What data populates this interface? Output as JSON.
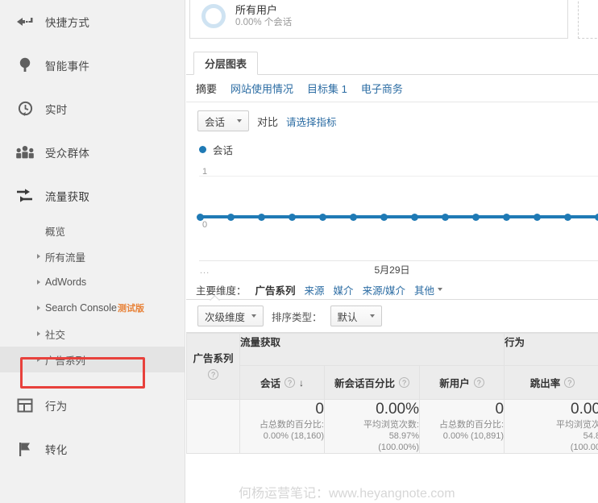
{
  "sidebar": {
    "items": [
      {
        "label": "快捷方式",
        "icon": "shortcut-arrow-icon"
      },
      {
        "label": "智能事件",
        "icon": "lightbulb-icon"
      },
      {
        "label": "实时",
        "icon": "clock-icon"
      },
      {
        "label": "受众群体",
        "icon": "people-group-icon"
      },
      {
        "label": "流量获取",
        "icon": "arrows-icon"
      }
    ],
    "acquisition_sub": [
      {
        "label": "概览",
        "caret": false,
        "highlighted": false,
        "beta": ""
      },
      {
        "label": "所有流量",
        "caret": true,
        "highlighted": false,
        "beta": ""
      },
      {
        "label": "AdWords",
        "caret": true,
        "highlighted": false,
        "beta": ""
      },
      {
        "label": "Search Console",
        "caret": true,
        "highlighted": false,
        "beta": "测试版"
      },
      {
        "label": "社交",
        "caret": true,
        "highlighted": false,
        "beta": ""
      },
      {
        "label": "广告系列",
        "caret": true,
        "highlighted": true,
        "beta": ""
      }
    ],
    "bottom_items": [
      {
        "label": "行为",
        "icon": "layout-icon"
      },
      {
        "label": "转化",
        "icon": "flag-icon"
      }
    ]
  },
  "segment": {
    "title": "所有用户",
    "percent": "0.00%",
    "unit": "个会话"
  },
  "tabs": {
    "main_tab": "分层图表",
    "sub_tabs": [
      {
        "label": "摘要",
        "active": true
      },
      {
        "label": "网站使用情况",
        "active": false
      },
      {
        "label": "目标集 1",
        "active": false
      },
      {
        "label": "电子商务",
        "active": false
      }
    ]
  },
  "chart_controls": {
    "metric_select": "会话",
    "compare_label": "对比",
    "compare_link": "请选择指标"
  },
  "chart_data": {
    "type": "line",
    "title": "",
    "legend": [
      "会话"
    ],
    "legend_position": "top-left",
    "series": [
      {
        "name": "会话",
        "color": "#1f7ab5",
        "values": [
          0,
          0,
          0,
          0,
          0,
          0,
          0,
          0,
          0,
          0,
          0,
          0,
          0,
          0
        ]
      }
    ],
    "x": [
      "",
      "",
      "",
      "",
      "",
      "",
      "",
      "",
      "",
      "",
      "",
      "",
      "",
      ""
    ],
    "xlabel": "5月29日",
    "ylabel": "",
    "ytick_labels": [
      "1",
      "0"
    ],
    "ylim": [
      0,
      1
    ],
    "grid": true,
    "x_prefix": "..."
  },
  "dimensions": {
    "caption": "主要维度：",
    "items": [
      {
        "label": "广告系列",
        "active": true
      },
      {
        "label": "来源",
        "active": false
      },
      {
        "label": "媒介",
        "active": false
      },
      {
        "label": "来源/媒介",
        "active": false
      }
    ],
    "more_label": "其他"
  },
  "filters": {
    "secondary_dimension": "次级维度",
    "sort_label": "排序类型：",
    "sort_value": "默认"
  },
  "table": {
    "dimension_header": "广告系列",
    "group_headers": [
      {
        "label": "流量获取",
        "span": 3
      },
      {
        "label": "行为",
        "span": 1
      }
    ],
    "columns": [
      {
        "label": "会话",
        "sorted": true,
        "sort_dir": "↓"
      },
      {
        "label": "新会话百分比",
        "sorted": false,
        "sort_dir": ""
      },
      {
        "label": "新用户",
        "sorted": false,
        "sort_dir": ""
      },
      {
        "label": "跳出率",
        "sorted": false,
        "sort_dir": ""
      }
    ],
    "totals_row": [
      {
        "value": "0",
        "sub_label": "占总数的百分比:",
        "sub_value": "0.00% (18,160)"
      },
      {
        "value": "0.00%",
        "sub_label": "平均浏览次数:",
        "sub_value": "58.97%",
        "sub_value2": "(100.00%)"
      },
      {
        "value": "0",
        "sub_label": "占总数的百分比:",
        "sub_value": "0.00% (10,891)"
      },
      {
        "value": "0.00",
        "sub_label": "平均浏览次",
        "sub_value": "54.8",
        "sub_value2": "(100.00"
      }
    ]
  },
  "watermark": "何杨运营笔记：www.heyangnote.com"
}
